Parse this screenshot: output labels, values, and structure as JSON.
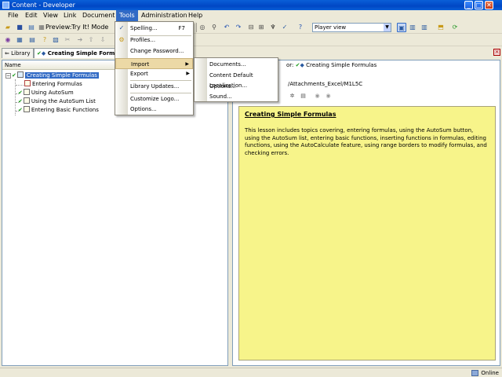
{
  "window": {
    "title": "Content - Developer",
    "minimize": "_",
    "maximize": "□",
    "close": "✕"
  },
  "menubar": [
    "File",
    "Edit",
    "View",
    "Link",
    "Document",
    "Tools",
    "Administration",
    "Help"
  ],
  "toolbar": {
    "preview_label": "Preview:",
    "preview_mode": "Try It! Mode",
    "player_view": "Player view"
  },
  "tabs": {
    "library": "Library",
    "outline": "Creating Simple Formulas"
  },
  "outline": {
    "column_header": "Name",
    "root": "Creating Simple Formulas",
    "children": [
      "Entering Formulas",
      "Using AutoSum",
      "Using the AutoSum List",
      "Entering Basic Functions"
    ]
  },
  "editor": {
    "header_prefix": "or:",
    "header_title": "Creating Simple Formulas",
    "path": "/Attachments_Excel/M1L5C",
    "heading": "Creating Simple Formulas",
    "body": "This lesson includes topics covering, entering formulas, using the AutoSum button, using the AutoSum list, entering basic functions, inserting functions in formulas, editing functions, using the AutoCalculate feature, using range borders to modify formulas, and checking errors."
  },
  "tools_menu": {
    "spelling": "Spelling...",
    "spelling_shortcut": "F7",
    "profiles": "Profiles...",
    "change_password": "Change Password...",
    "import": "Import",
    "export": "Export",
    "library_updates": "Library Updates...",
    "customize_logo": "Customize Logo...",
    "options": "Options..."
  },
  "import_menu": {
    "documents": "Documents...",
    "content_defaults": "Content Default Options...",
    "localization": "Localization...",
    "sound": "Sound..."
  },
  "status": {
    "text": "Online"
  }
}
